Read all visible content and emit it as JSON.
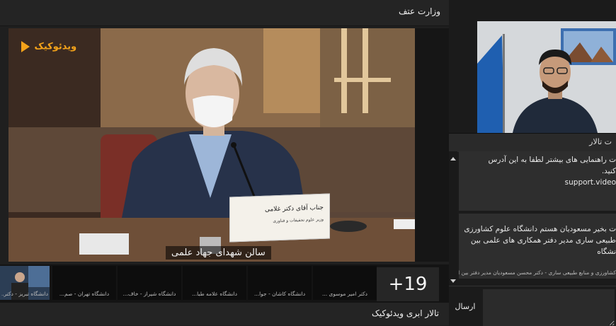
{
  "top_bar": {
    "title": "وزارت عتف"
  },
  "bottom_bar": {
    "title": "تالار ابری ویدئوکیک"
  },
  "video": {
    "logo_text": "ویدئوکیک",
    "caption": "سالن شهدای جهاد علمی",
    "name_plate": {
      "name": "جناب آقای دکتر غلامی",
      "role": "وزیر علوم تحقیقات و فناوری"
    }
  },
  "thumbnails": [
    {
      "label": "دانشگاه تبریز - دکتر..."
    },
    {
      "label": "دانشگاه تهران - صم..."
    },
    {
      "label": "دانشگاه شیراز - خاف..."
    },
    {
      "label": "دانشگاه علامه طبا..."
    },
    {
      "label": "دانشگاه کاشان - جوا..."
    },
    {
      "label": "دکتر امیر موسوی ..."
    }
  ],
  "more_participants": "+19",
  "chat": {
    "header": "ت تالار",
    "messages": [
      {
        "lines": [
          "ت راهنمایی های بیشتر لطفا به این آدرس",
          "کنید.",
          "support.video"
        ]
      },
      {
        "lines": [
          "ت بخیر مسعودیان هستم دانشگاه علوم کشاورزی",
          "طبیعی ساری مدیر دفتر همکاری های علمی بین",
          "نشگاه"
        ],
        "sender": "کشاورزی و منابع طبیعی ساری - دکتر محسن مسعودیان مدیر دفتر بین الملل"
      }
    ],
    "input": {
      "value": "",
      "placeholder": ""
    },
    "send_label": "ارسال"
  }
}
